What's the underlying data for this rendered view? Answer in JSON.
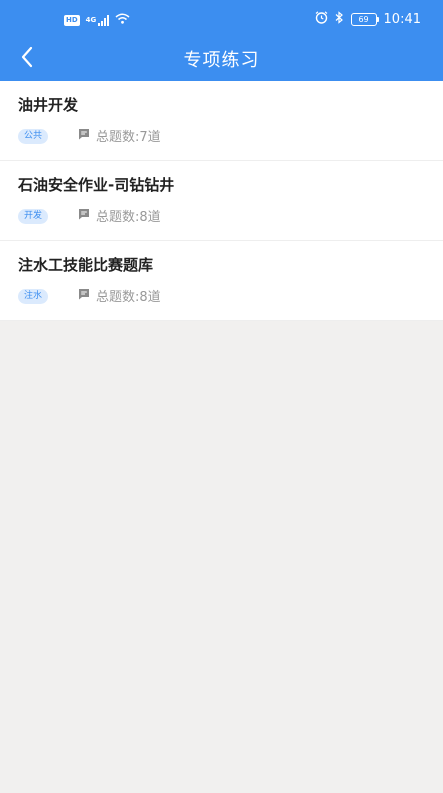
{
  "status_bar": {
    "network": "4G",
    "hd_label": "HD",
    "battery": "69",
    "time": "10:41"
  },
  "nav": {
    "title": "专项练习"
  },
  "items": [
    {
      "title": "油井开发",
      "tag": "公共",
      "count": "总题数:7道"
    },
    {
      "title": "石油安全作业-司钻钻井",
      "tag": "开发",
      "count": "总题数:8道"
    },
    {
      "title": "注水工技能比赛题库",
      "tag": "注水",
      "count": "总题数:8道"
    }
  ],
  "colors": {
    "primary": "#3c8ef0",
    "background": "#f1f0ef",
    "tag_bg": "#dbeafd"
  },
  "icons": {
    "back": "chevron-left-icon",
    "question_count": "comment-icon"
  }
}
